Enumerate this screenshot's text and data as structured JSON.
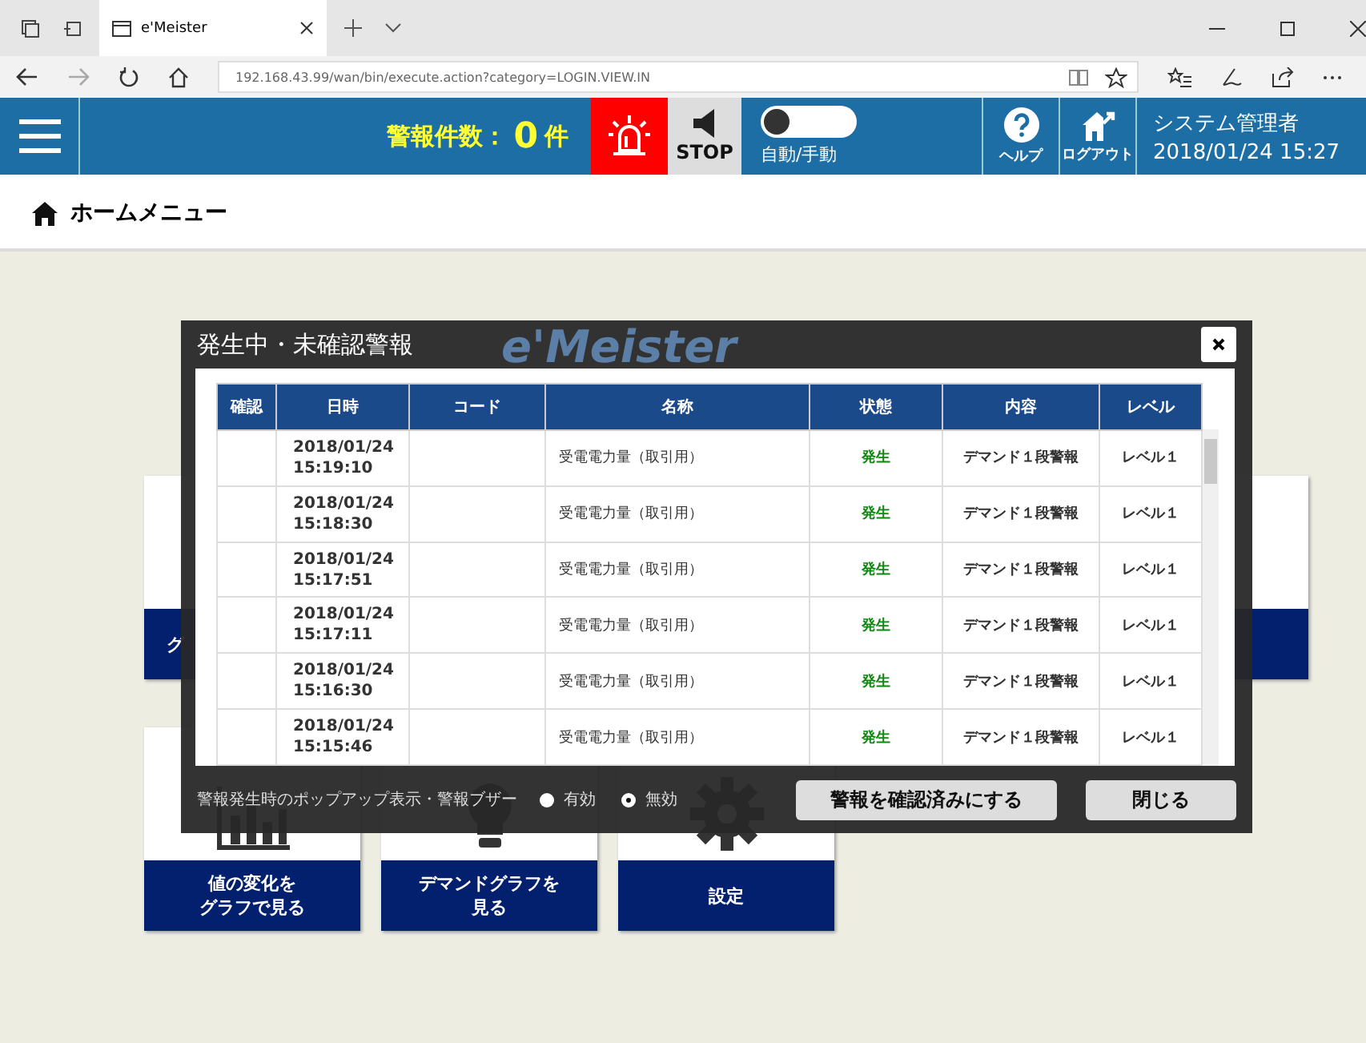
{
  "browser": {
    "tab_title": "e'Meister",
    "address": "192.168.43.99/wan/bin/execute.action?category=LOGIN.VIEW.IN"
  },
  "header": {
    "alarm_label": "警報件数：",
    "alarm_count": "0",
    "alarm_unit": "件",
    "stop_label": "STOP",
    "toggle": {
      "label": "自動/手動",
      "on": false
    },
    "help_label": "ヘルプ",
    "logout_label": "ログアウト",
    "user": "システム管理者",
    "datetime": "2018/01/24 15:27"
  },
  "breadcrumb": "ホームメニュー",
  "tiles": [
    {
      "kind": "plain",
      "lines": [
        "グ"
      ]
    },
    {
      "kind": "plain"
    },
    {
      "kind": "chart",
      "lines": [
        "値の変化を",
        "グラフで見る"
      ]
    },
    {
      "kind": "bulb",
      "lines": [
        "デマンドグラフを",
        "見る"
      ]
    },
    {
      "kind": "gear",
      "lines": [
        "設定"
      ]
    }
  ],
  "dialog": {
    "title": "発生中・未確認警報",
    "logo": "e'Meister",
    "table": {
      "columns": [
        "確認",
        "日時",
        "コード",
        "名称",
        "状態",
        "内容",
        "レベル"
      ],
      "rows": [
        [
          "",
          "2018/01/24\n15:19:10",
          "",
          "受電電力量（取引用）",
          "発生",
          "デマンド１段警報",
          "レベル１"
        ],
        [
          "",
          "2018/01/24\n15:18:30",
          "",
          "受電電力量（取引用）",
          "発生",
          "デマンド１段警報",
          "レベル１"
        ],
        [
          "",
          "2018/01/24\n15:17:51",
          "",
          "受電電力量（取引用）",
          "発生",
          "デマンド１段警報",
          "レベル１"
        ],
        [
          "",
          "2018/01/24\n15:17:11",
          "",
          "受電電力量（取引用）",
          "発生",
          "デマンド１段警報",
          "レベル１"
        ],
        [
          "",
          "2018/01/24\n15:16:30",
          "",
          "受電電力量（取引用）",
          "発生",
          "デマンド１段警報",
          "レベル１"
        ],
        [
          "",
          "2018/01/24\n15:15:46",
          "",
          "受電電力量（取引用）",
          "発生",
          "デマンド１段警報",
          "レベル１"
        ]
      ]
    },
    "popup_setting_label": "警報発生時のポップアップ表示・警報ブザー",
    "options": [
      {
        "label": "有効",
        "selected": false
      },
      {
        "label": "無効",
        "selected": true
      }
    ],
    "buttons": [
      "警報を確認済みにする",
      "閉じる"
    ]
  }
}
